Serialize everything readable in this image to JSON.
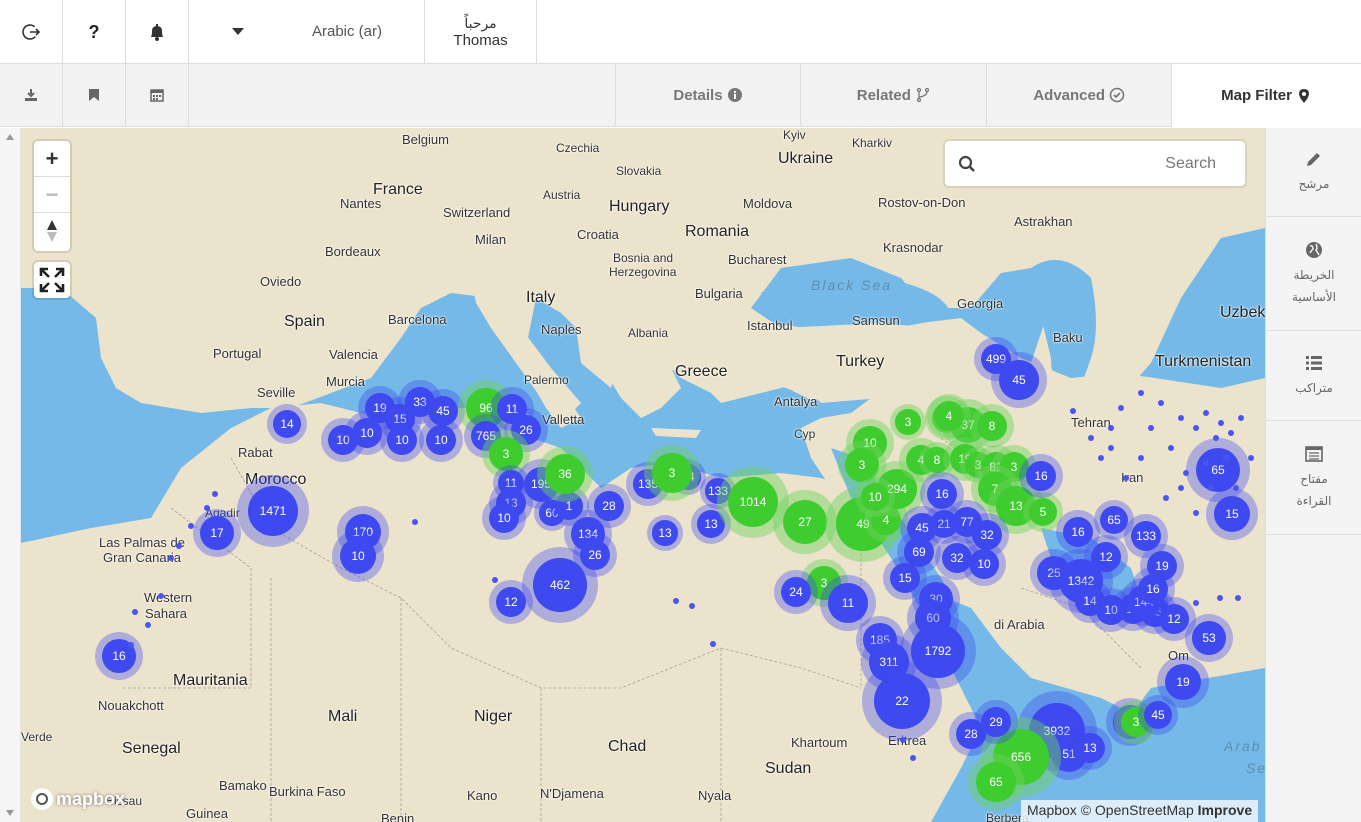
{
  "topbar": {
    "logout_icon": "logout-icon",
    "help_icon": "help-icon",
    "bell_icon": "bell-icon",
    "language_label": "Arabic (ar)",
    "greeting": "مرحباً",
    "user_name": "Thomas"
  },
  "subbar": {
    "icons": [
      "download-icon",
      "bookmark-icon",
      "calendar-icon"
    ],
    "tabs": [
      {
        "label": "Details",
        "icon": "info-circle-icon"
      },
      {
        "label": "Related",
        "icon": "fork-icon"
      },
      {
        "label": "Advanced",
        "icon": "check-circle-icon"
      },
      {
        "label": "Map Filter",
        "icon": "map-marker-icon"
      }
    ]
  },
  "map": {
    "search_placeholder": "Search",
    "logo_text": "mapbox",
    "attribution_text": "Mapbox © OpenStreetMap",
    "attribution_improve": "Improve",
    "labels": [
      "Belgium",
      "Czechia",
      "Kyiv",
      "Kharkiv",
      "Ukraine",
      "Slovakia",
      "France",
      "Austria",
      "Hungary",
      "Moldova",
      "Rostov-on-Don",
      "Nantes",
      "Switzerland",
      "Astrakhan",
      "Milan",
      "Croatia",
      "Romania",
      "Krasnodar",
      "Bordeaux",
      "Bosnia and",
      "Herzegovina",
      "Bucharest",
      "Black Sea",
      "Oviedo",
      "Italy",
      "Bulgaria",
      "Georgia",
      "Spain",
      "Barcelona",
      "Naples",
      "Istanbul",
      "Samsun",
      "Baku",
      "Portugal",
      "Valencia",
      "Albania",
      "Turkey",
      "Turkmenistan",
      "Uzbek",
      "Murcia",
      "Palermo",
      "Greece",
      "Seville",
      "Valletta",
      "Antalya",
      "Rabat",
      "Morocco",
      "Cyp",
      "Tehran",
      "Agadir",
      "Iran",
      "Las Palmas de",
      "Gran Canaria",
      "Western",
      "Sahara",
      "di Arabia",
      "Om",
      "Mauritania",
      "Nouakchott",
      "Mali",
      "Niger",
      "Chad",
      "Khartoum",
      "Sudan",
      "Eritrea",
      "Arab",
      "Se",
      "Verde",
      "Senegal",
      "Bamako",
      "Burkina Faso",
      "Kano",
      "N'Djamena",
      "Nyala",
      "Bissau",
      "Guinea",
      "Benin",
      "Berbera"
    ],
    "clusters": [
      "1471",
      "17",
      "16",
      "14",
      "10",
      "19",
      "15",
      "33",
      "45",
      "10",
      "10",
      "10",
      "96",
      "11",
      "765",
      "26",
      "3",
      "11",
      "13",
      "10",
      "195",
      "60",
      "1",
      "28",
      "36",
      "134",
      "26",
      "462",
      "12",
      "170",
      "10",
      "135",
      "44",
      "3",
      "13",
      "133",
      "13",
      "1014",
      "27",
      "49",
      "4",
      "10",
      "3",
      "294",
      "10",
      "4",
      "4",
      "37",
      "8",
      "3",
      "4",
      "8",
      "19",
      "3",
      "81",
      "3",
      "7",
      "13",
      "5",
      "16",
      "16",
      "21",
      "77",
      "32",
      "45",
      "69",
      "32",
      "15",
      "30",
      "60",
      "185",
      "311",
      "1792",
      "22",
      "3",
      "24",
      "11",
      "133",
      "10",
      "16",
      "65",
      "12",
      "25",
      "1342",
      "14",
      "10",
      "14",
      "16",
      "12",
      "53",
      "144",
      "19",
      "499",
      "45",
      "65",
      "15",
      "16",
      "19",
      "10",
      "3",
      "45",
      "3932",
      "51",
      "13",
      "28",
      "656",
      "65",
      "29"
    ]
  },
  "right_panel": {
    "items": [
      {
        "label": "مرشح",
        "icon": "pencil-icon"
      },
      {
        "label": "الخريطة الأساسية",
        "icon": "globe-icon"
      },
      {
        "label": "متراكب",
        "icon": "list-icon"
      },
      {
        "label": "مفتاح القراءة",
        "icon": "legend-icon"
      }
    ]
  },
  "colors": {
    "cluster_blue": "#3e49ef",
    "cluster_green": "#3fcc2e",
    "water": "#74b9e7",
    "land": "#ece3cc"
  }
}
